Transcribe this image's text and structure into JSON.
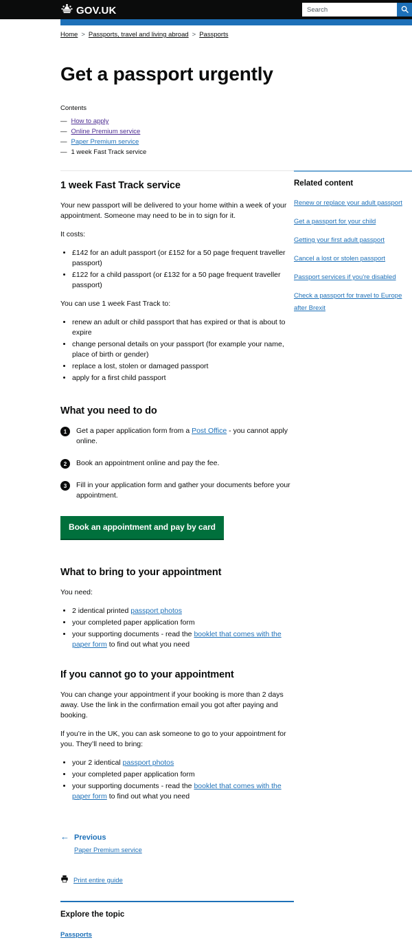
{
  "header": {
    "logo_text": "GOV.UK",
    "crown_icon": "crown-icon",
    "search_placeholder": "Search",
    "search_value": "",
    "search_icon": "search-icon"
  },
  "breadcrumbs": [
    {
      "label": "Home"
    },
    {
      "label": "Passports, travel and living abroad"
    },
    {
      "label": "Passports"
    }
  ],
  "breadcrumb_separator": ">",
  "page": {
    "title": "Get a passport urgently"
  },
  "contents": {
    "label": "Contents",
    "dash": "—",
    "items": [
      {
        "label": "How to apply",
        "state": "visited"
      },
      {
        "label": "Online Premium service",
        "state": "visited"
      },
      {
        "label": "Paper Premium service",
        "state": "unvisited"
      },
      {
        "label": "1 week Fast Track service",
        "state": "current"
      }
    ]
  },
  "main": {
    "heading": "1 week Fast Track service",
    "intro": "Your new passport will be delivered to your home within a week of your appointment. Someone may need to be in to sign for it.",
    "costs_label": "It costs:",
    "costs": [
      "£142 for an adult passport (or £152 for a 50 page frequent traveller passport)",
      "£122 for a child passport (or £132 for a 50 page frequent traveller passport)"
    ],
    "uses_label": "You can use 1 week Fast Track to:",
    "uses": [
      "renew an adult or child passport that has expired or that is about to expire",
      "change personal details on your passport (for example your name, place of birth or gender)",
      "replace a lost, stolen or damaged passport",
      "apply for a first child passport"
    ],
    "steps_heading": "What you need to do",
    "steps": [
      {
        "number": "1",
        "text_before": "Get a paper application form from a ",
        "link": "Post Office",
        "text_after": " - you cannot apply online."
      },
      {
        "number": "2",
        "text_before": "Book an appointment online and pay the fee.",
        "link": "",
        "text_after": ""
      },
      {
        "number": "3",
        "text_before": "Fill in your application form and gather your documents before your appointment.",
        "link": "",
        "text_after": ""
      }
    ],
    "start_button": "Book an appointment and pay by card",
    "bring_heading": "What to bring to your appointment",
    "bring_label": "You need:",
    "bring_items": [
      {
        "before": "2 identical printed ",
        "link": "passport photos",
        "after": ""
      },
      {
        "before": "your completed paper application form",
        "link": "",
        "after": ""
      },
      {
        "before": "your supporting documents - read the ",
        "link": "booklet that comes with the paper form",
        "after": " to find out what you need"
      }
    ],
    "cannot_go_heading": "If you cannot go to your appointment",
    "cannot_go_p1": "You can change your appointment if your booking is more than 2 days away. Use the link in the confirmation email you got after paying and booking.",
    "cannot_go_p2": "If you’re in the UK, you can ask someone to go to your appointment for you. They’ll need to bring:",
    "cannot_go_items": [
      {
        "before": "your 2 identical ",
        "link": "passport photos",
        "after": ""
      },
      {
        "before": "your completed paper application form",
        "link": "",
        "after": ""
      },
      {
        "before": "your supporting documents - read the ",
        "link": "booklet that comes with the paper form",
        "after": " to find out what you need"
      }
    ]
  },
  "pagination": {
    "arrow_icon": "arrow-left-icon",
    "previous_label": "Previous",
    "previous_title": "Paper Premium service"
  },
  "print": {
    "icon": "printer-icon",
    "label": "Print entire guide"
  },
  "explore": {
    "heading": "Explore the topic",
    "items": [
      {
        "label": "Passports"
      }
    ]
  },
  "sidebar": {
    "title": "Related content",
    "items": [
      {
        "label": "Renew or replace your adult passport"
      },
      {
        "label": "Get a passport for your child"
      },
      {
        "label": "Getting your first adult passport"
      },
      {
        "label": "Cancel a lost or stolen passport"
      },
      {
        "label": "Passport services if you're disabled"
      },
      {
        "label": "Check a passport for travel to Europe after Brexit"
      }
    ]
  },
  "colors": {
    "black": "#0b0c0c",
    "blue": "#1d70b8",
    "visited_purple": "#4c2c92",
    "green": "#00703c",
    "rule_light_blue": "#6ea8d4",
    "grey_rule": "#e6e6e6"
  }
}
